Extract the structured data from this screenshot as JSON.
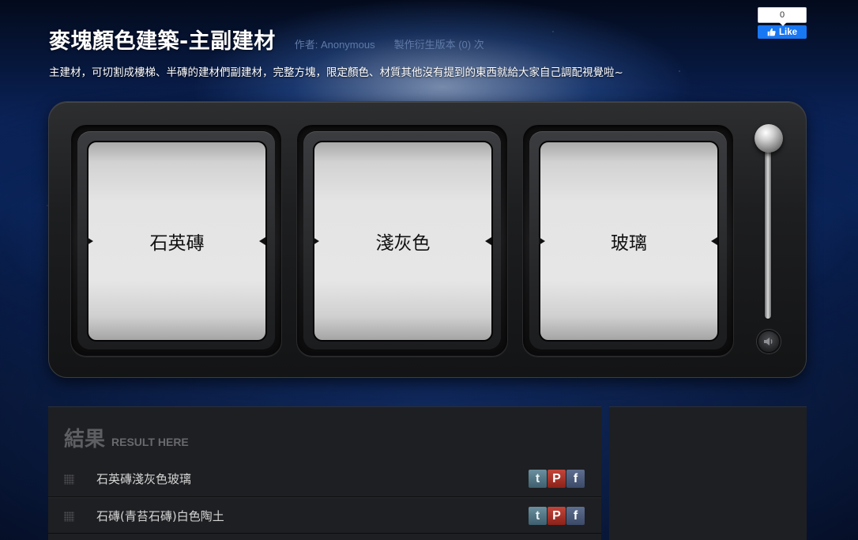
{
  "header": {
    "title": "麥塊顏色建築-主副建材",
    "author": "作者: Anonymous",
    "versions": "製作衍生版本 (0) 次",
    "description": "主建材，可切割成樓梯、半磚的建材們副建材，完整方塊，限定顏色、材質其他沒有提到的東西就給大家自己調配視覺啦~"
  },
  "facebook": {
    "count": "0",
    "like_label": "Like"
  },
  "slot_machine": {
    "reels": [
      {
        "value": "石英磚"
      },
      {
        "value": "淺灰色"
      },
      {
        "value": "玻璃"
      }
    ],
    "icons": {
      "lever": "lever-knob",
      "sound": "speaker-icon"
    }
  },
  "results": {
    "title": "結果",
    "subtitle": "RESULT HERE",
    "rows": [
      {
        "text": "石英磚淺灰色玻璃"
      },
      {
        "text": "石磚(青苔石磚)白色陶土"
      }
    ],
    "share_icons": [
      "twitter-icon",
      "plurk-icon",
      "facebook-icon"
    ]
  },
  "colors": {
    "background": "#0b2a66",
    "panel": "#1e1f22",
    "reel_face": "#e4e4e4",
    "facebook_blue": "#1877f2"
  }
}
